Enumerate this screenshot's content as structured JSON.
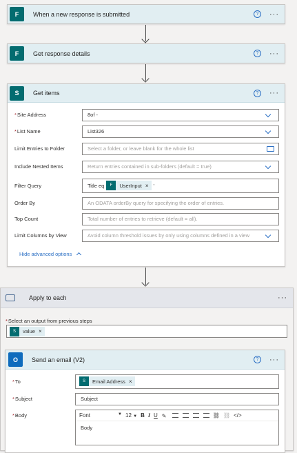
{
  "colors": {
    "accent": "#2b6fc4",
    "header_bg": "#e1eef2",
    "icon_teal": "#036c70",
    "required": "#a4262c"
  },
  "step1": {
    "title": "When a new response is submitted",
    "icon": "forms-icon"
  },
  "step2": {
    "title": "Get response details",
    "icon": "forms-icon"
  },
  "step3": {
    "title": "Get items",
    "icon": "sharepoint-icon",
    "site_address": {
      "label": "Site Address",
      "value": "8of -"
    },
    "list_name": {
      "label": "List Name",
      "value": "List326"
    },
    "limit_folder": {
      "label": "Limit Entries to Folder",
      "placeholder": "Select a folder, or leave blank for the whole list"
    },
    "include_nested": {
      "label": "Include Nested Items",
      "placeholder": "Return entries contained in sub-folders (default = true)"
    },
    "filter_query": {
      "label": "Filter Query",
      "prefix": "Title eq",
      "token": "UserInput",
      "suffix": "'"
    },
    "order_by": {
      "label": "Order By",
      "placeholder": "An ODATA orderBy query for specifying the order of entries."
    },
    "top_count": {
      "label": "Top Count",
      "placeholder": "Total number of entries to retrieve (default = all)."
    },
    "limit_columns": {
      "label": "Limit Columns by View",
      "placeholder": "Avoid column threshold issues by only using columns defined in a view"
    },
    "hide_advanced": "Hide advanced options"
  },
  "apply_each": {
    "title": "Apply to each",
    "output_label": "Select an output from previous steps",
    "token": "value"
  },
  "email": {
    "title": "Send an email (V2)",
    "to": {
      "label": "To",
      "token": "Email Address"
    },
    "subject": {
      "label": "Subject",
      "value": "Subject"
    },
    "body": {
      "label": "Body",
      "font": "Font",
      "size": "12",
      "value": "Body"
    }
  },
  "help_glyph": "?",
  "more_glyph": "···",
  "close_glyph": "×"
}
